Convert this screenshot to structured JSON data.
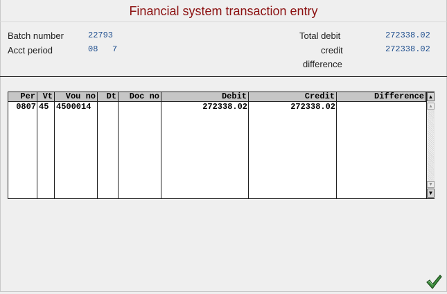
{
  "window": {
    "title": "Financial system transaction entry"
  },
  "batch": {
    "batch_number_label": "Batch number",
    "batch_number": "22793",
    "acct_period_label": "Acct period",
    "acct_period_month": "08",
    "acct_period_year": "7"
  },
  "totals": {
    "total_debit_label": "Total debit",
    "total_debit": "272338.02",
    "credit_label": "credit",
    "credit": "272338.02",
    "difference_label": "difference",
    "difference": ""
  },
  "grid": {
    "columns": [
      "Per",
      "Vt",
      "Vou no",
      "Dt",
      "Doc no",
      "Debit",
      "Credit",
      "Difference"
    ],
    "rows": [
      {
        "per": "0807",
        "vt": "45",
        "vou_no": "4500014",
        "dt": "",
        "doc_no": "",
        "debit": "272338.02",
        "credit": "272338.02",
        "difference": ""
      }
    ]
  },
  "icons": {
    "scroll_up": "scroll-top-icon",
    "scroll_down": "scroll-bottom-icon",
    "confirm": "checkmark-icon"
  },
  "colors": {
    "title": "#8b1010",
    "values": "#1f4f8f",
    "background": "#efefef"
  }
}
